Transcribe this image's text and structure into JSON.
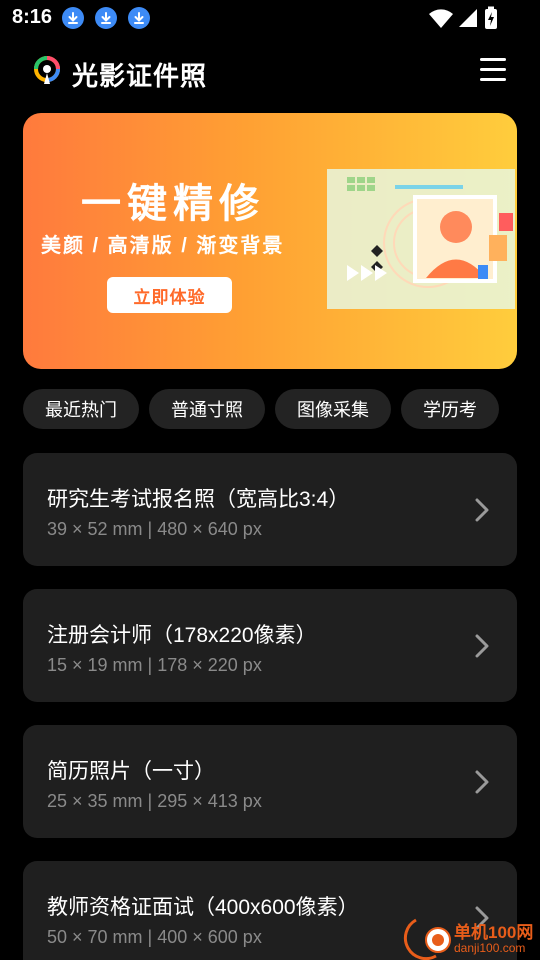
{
  "status_bar": {
    "time": "8:16",
    "download_icons": [
      "download-icon",
      "download-icon",
      "download-icon"
    ],
    "icons": [
      "wifi-icon",
      "signal-icon",
      "battery-charging-icon"
    ]
  },
  "app_bar": {
    "title": "光影证件照",
    "menu_icon": "hamburger-menu-icon"
  },
  "banner": {
    "title": "一键精修",
    "subtitle": "美颜 / 高清版 / 渐变背景",
    "button_label": "立即体验",
    "gradient": [
      "#ff7a3d",
      "#ffcd3c"
    ]
  },
  "chips": [
    {
      "label": "最近热门"
    },
    {
      "label": "普通寸照"
    },
    {
      "label": "图像采集"
    },
    {
      "label": "学历考"
    }
  ],
  "cards": [
    {
      "title": "研究生考试报名照（宽高比3:4）",
      "spec": "39 × 52 mm | 480 × 640 px"
    },
    {
      "title": "注册会计师（178x220像素）",
      "spec": "15 × 19 mm | 178 × 220 px"
    },
    {
      "title": "简历照片（一寸）",
      "spec": "25 × 35 mm | 295 × 413 px"
    },
    {
      "title": "教师资格证面试（400x600像素）",
      "spec": "50 × 70 mm | 400 × 600 px"
    }
  ],
  "watermark": {
    "line1": "单机100网",
    "line2": "danji100.com"
  },
  "colors": {
    "background": "#000000",
    "card": "#1f1f1f",
    "chip": "#232323",
    "accent": "#ff6a2a",
    "secondary_text": "#8a8a8a"
  }
}
